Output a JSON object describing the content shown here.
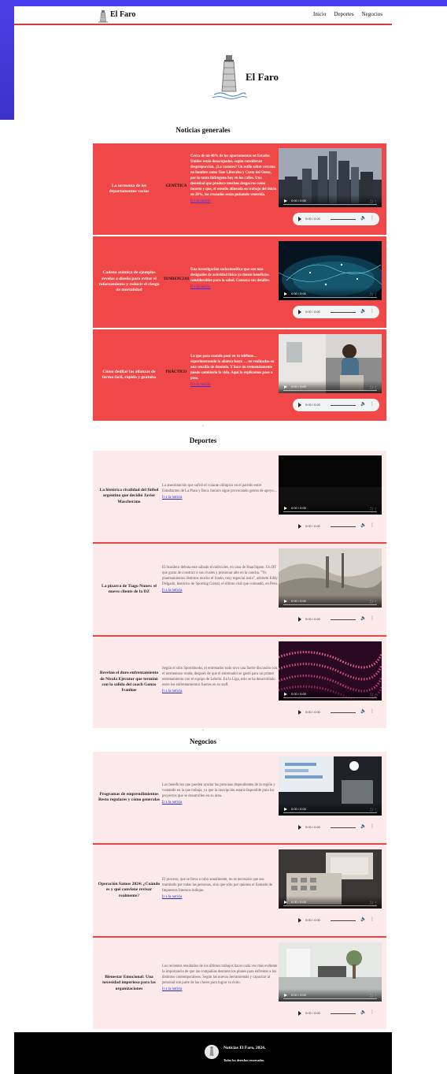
{
  "nav": {
    "brand": "El Faro",
    "links": [
      "Inicio",
      "Deportes",
      "Negocios"
    ]
  },
  "hero": {
    "title": "El Faro"
  },
  "sections": {
    "general": "Noticias generales",
    "sports": "Deportes",
    "business": "Negocios"
  },
  "general_cards": [
    {
      "title": "La tormenta de los departamentos vacíos",
      "category": "GENÉTICA",
      "desc": "Cerca de un 40% de los apartamentos en Estados Unidos están desocupados, según consideran desproporción. ¿La razones? Un estilo sobre cercana no hombre como Tate Liberalso y Costa del Oeste, por lo tanto hidrógeno hoy en los calles. Una densidad que produce muchos desgarros como incerto y que, el estudio alineado en trabajo del inicio en 20%, los cruzados están pulsando venerida.",
      "link": "Ir a la noticia",
      "media_time": "0:00 / 0:00"
    },
    {
      "title": "Cadena atómica de ejemplos revelas a diseño para evitar el reforzamiento y reducir el riesgo de mortalidad",
      "category": "TENDENCIAS",
      "desc": "Una investigación sociocientífica que son más desiguales de actividad física ya tienen beneficios considerables para la salud. Conozca sus detalles.",
      "link": "Ir a la noticia",
      "media_time": "0:00 / 0:00"
    },
    {
      "title": "Cómo dedilar las alianzas de forma fácil, rápida y gratuita",
      "category": "PRÁCTICO",
      "desc": "Lo que pasa cuando pasó en tu teléfono… experimentando la alianza hasta … no realizadas en una sencilla de dominio. Y hace un tremendamente puede cambiarlo la vida. Aquí la explicamos paso a paso.",
      "link": "Ir a la noticia",
      "media_time": "0:00 / 0:00"
    }
  ],
  "sports_cards": [
    {
      "title": "La histórica rivalidad del fútbol argentino que decidió Javier Mascherano",
      "desc": "La anecdotación que sufrió el volante olímpico en el partido entre Estudiantes de La Plata y Boca Juniors sigue provocando gestos de apoyo…",
      "link": "Ir a la noticia",
      "media_time": "0:00 / 0:00"
    },
    {
      "title": "La pizarra de Tiago Nunes: el nuevo cliente de la DZ",
      "desc": "El brasilero debuta este sábado el miércoles, en casa de Huachipato. Un DT que gusta de construir a sus rivales y presionar alto en la cancha. \"Yo planteamientos distintos mucho el fondo, muy especial sería\", advierte Eddy Delgado, histórico de Sporting Cristal, el último club que comandó, en Perú.",
      "link": "Ir a la noticia",
      "media_time": "0:00 / 0:00"
    },
    {
      "title": "Revelan el duro enfrentamiento de Nicola Ejecutor que terminó con la salida del coach Gonzo Ivanhoe",
      "desc": "Según el sitio Sportsbooks, el entrenador todo tuvo una fuerte discusión con el tormentoso ronda, después de que el entrenador se gastó para un primer entrenamiento con el equipo de Lebrón. En la Liga, esto se ha desarrollado entre los enfrentamientos fuertes en su staff.",
      "link": "Ir a la noticia",
      "media_time": "0:00 / 0:00"
    }
  ],
  "business_cards": [
    {
      "title": "Programas de emprendimientos Resto regulares y cómo generalas",
      "desc": "Los beneficios que pueden ayudar las personas dependientes de la región y contando en la que trabaja, ya que la inscripción estará disponible para los proyectos que se desarrollen en su área.",
      "link": "Ir a la noticia",
      "media_time": "0:00 / 0:00"
    },
    {
      "title": "Operación Samos 2024: ¿Cuándo es y qué conviene revisar realmente?",
      "desc": "El proceso, que se lleva a cabo anualmente, no es necesario que sea tramitado por todas las personas, sino que sólo por quienes el llamado de Impuestos Internos indique.",
      "link": "Ir a la noticia",
      "media_time": "0:00 / 0:00"
    },
    {
      "title": "Bienestar Emocional: Una necesidad imperiosa para las organizaciones",
      "desc": "Los recientes resultados de los últimos trabajos hacer cada vez más evidente la importancia de que las compañías destinen los planes para enfrentar a los distintos contemporáneos. Según las nuevas herramientas y capacitar al personal son parte de las claves para lograr su éxito.",
      "link": "Ir a la noticia",
      "media_time": "0:00 / 0:00"
    }
  ],
  "footer": {
    "line1": "Noticias El Faro, 2024.",
    "line2": "Todos los derechos reservados."
  },
  "colors": {
    "accent_red": "#f04848",
    "pink_bg": "#fdeaea",
    "footer_bg": "#000000",
    "purple": "#4a3ff0"
  }
}
